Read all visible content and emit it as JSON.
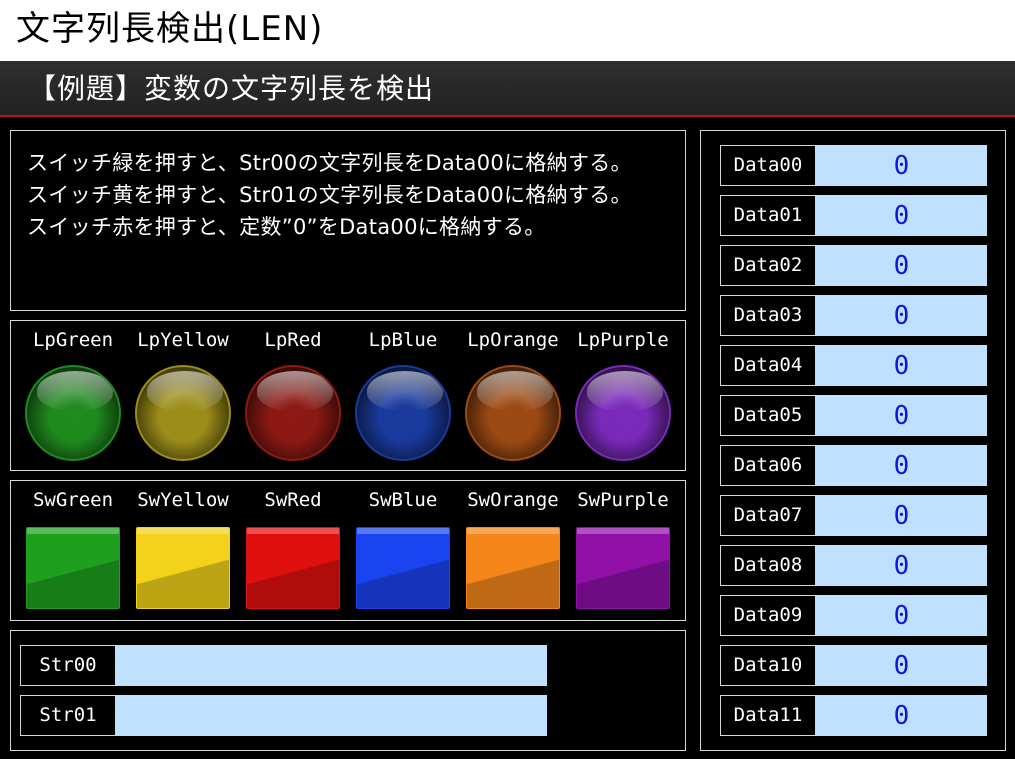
{
  "title": "文字列長検出(LEN)",
  "subtitle": "【例題】変数の文字列長を検出",
  "description": [
    "スイッチ緑を押すと、Str00の文字列長をData00に格納する。",
    "スイッチ黄を押すと、Str01の文字列長をData00に格納する。",
    "スイッチ赤を押すと、定数”0”をData00に格納する。"
  ],
  "lamps": [
    {
      "label": "LpGreen",
      "color": "#1f8a1f"
    },
    {
      "label": "LpYellow",
      "color": "#9c8d1a"
    },
    {
      "label": "LpRed",
      "color": "#8c1a14"
    },
    {
      "label": "LpBlue",
      "color": "#1a3a9c"
    },
    {
      "label": "LpOrange",
      "color": "#9c4a14"
    },
    {
      "label": "LpPurple",
      "color": "#7a2ab8"
    }
  ],
  "switches": [
    {
      "label": "SwGreen",
      "color": "#1ea01e"
    },
    {
      "label": "SwYellow",
      "color": "#f2d21a"
    },
    {
      "label": "SwRed",
      "color": "#e01010"
    },
    {
      "label": "SwBlue",
      "color": "#1a44f0"
    },
    {
      "label": "SwOrange",
      "color": "#f5871a"
    },
    {
      "label": "SwPurple",
      "color": "#9010a8"
    }
  ],
  "strings": [
    {
      "label": "Str00",
      "value": ""
    },
    {
      "label": "Str01",
      "value": ""
    }
  ],
  "data_registers": [
    {
      "label": "Data00",
      "value": "0"
    },
    {
      "label": "Data01",
      "value": "0"
    },
    {
      "label": "Data02",
      "value": "0"
    },
    {
      "label": "Data03",
      "value": "0"
    },
    {
      "label": "Data04",
      "value": "0"
    },
    {
      "label": "Data05",
      "value": "0"
    },
    {
      "label": "Data06",
      "value": "0"
    },
    {
      "label": "Data07",
      "value": "0"
    },
    {
      "label": "Data08",
      "value": "0"
    },
    {
      "label": "Data09",
      "value": "0"
    },
    {
      "label": "Data10",
      "value": "0"
    },
    {
      "label": "Data11",
      "value": "0"
    }
  ]
}
